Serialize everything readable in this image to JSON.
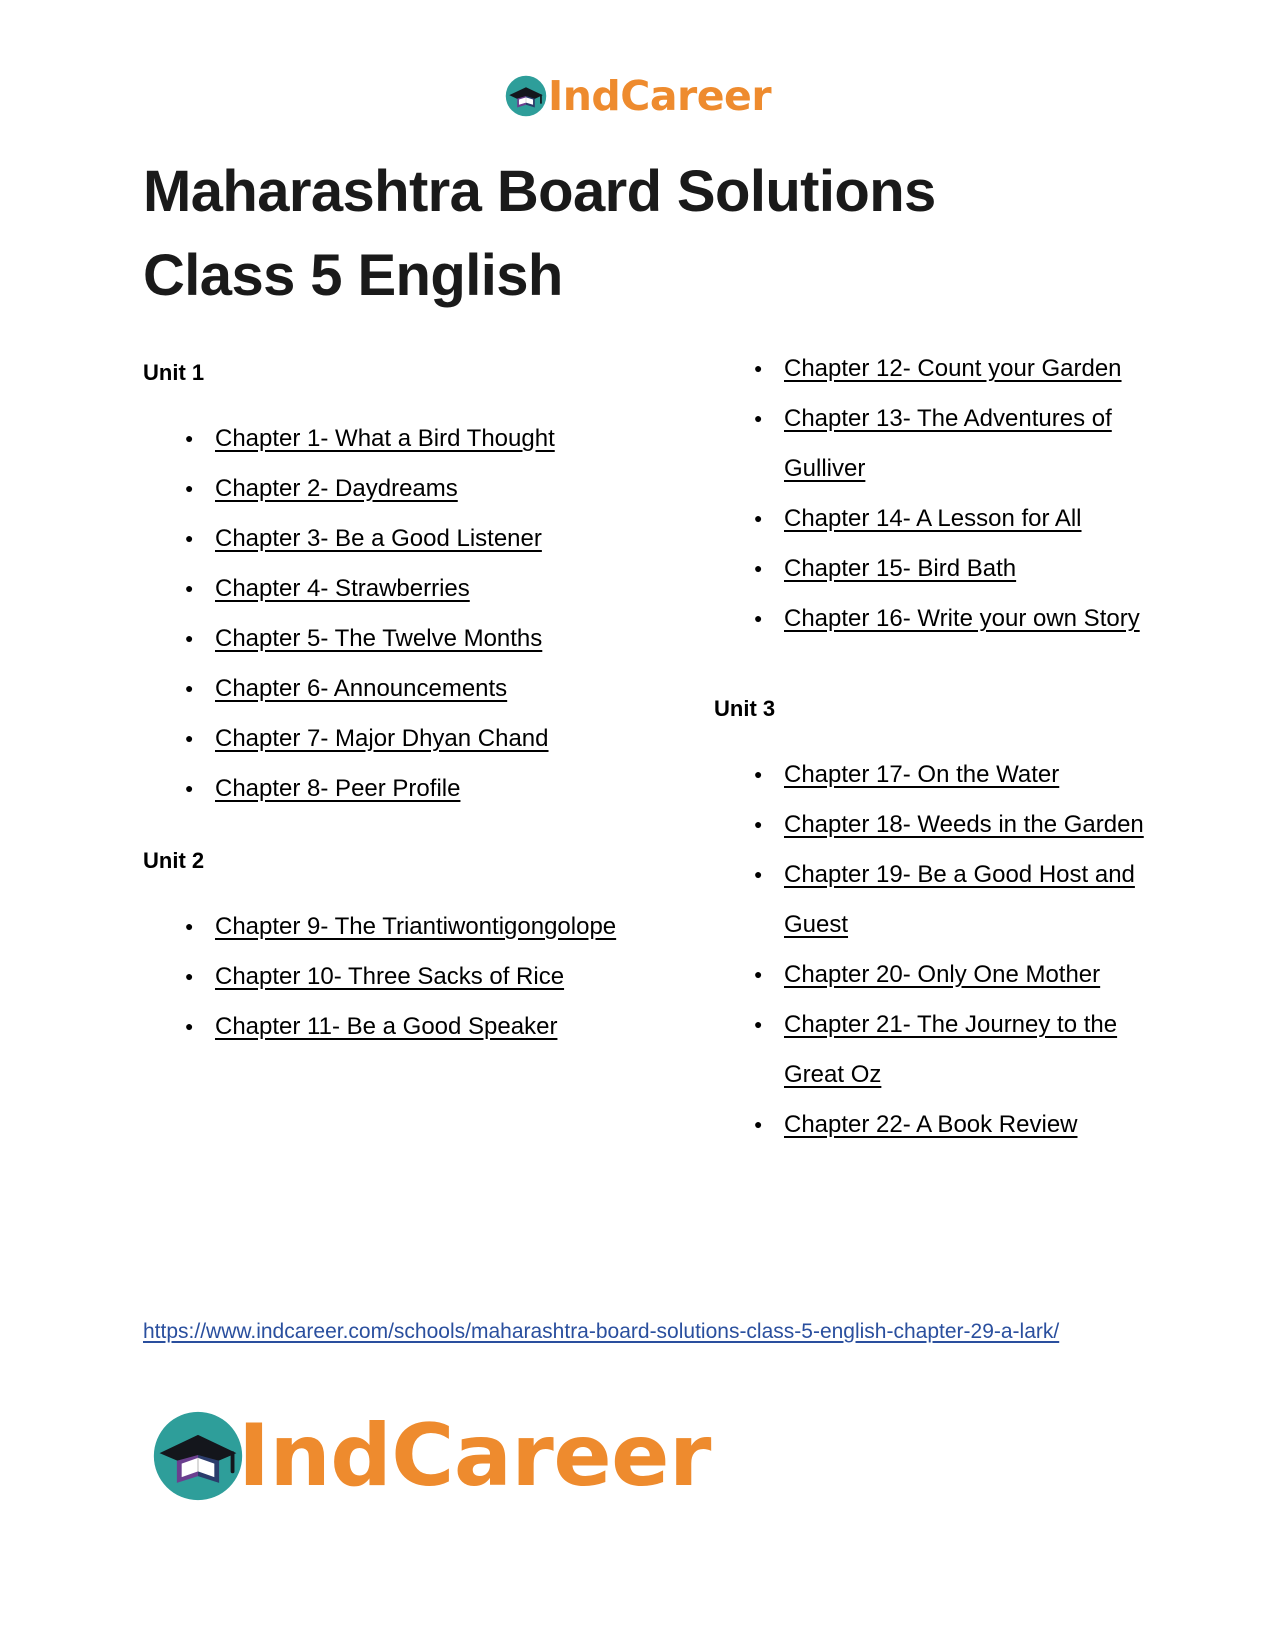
{
  "brand": {
    "name": "IndCareer",
    "logo_icon": "graduation-cap-book-icon",
    "orange": "#ee8b2e",
    "teal": "#2e9e9a"
  },
  "title": "Maharashtra Board Solutions Class 5 English",
  "columns": {
    "left": [
      {
        "heading": "Unit 1",
        "chapters": [
          "Chapter 1- What a Bird Thought",
          "Chapter 2- Daydreams",
          "Chapter 3- Be a Good Listener",
          "Chapter 4- Strawberries",
          "Chapter 5- The Twelve Months",
          "Chapter 6- Announcements",
          "Chapter 7- Major Dhyan Chand",
          "Chapter 8- Peer Profile"
        ]
      },
      {
        "heading": "Unit 2",
        "chapters": [
          "Chapter 9- The Triantiwontigongolope",
          "Chapter 10- Three Sacks of Rice",
          "Chapter 11- Be a Good Speaker"
        ]
      }
    ],
    "right": [
      {
        "heading": "",
        "chapters": [
          "Chapter 12- Count your Garden",
          "Chapter 13- The Adventures of Gulliver",
          "Chapter 14- A Lesson for All",
          "Chapter 15- Bird Bath",
          "Chapter 16- Write your own Story"
        ]
      },
      {
        "heading": "Unit 3",
        "chapters": [
          "Chapter 17- On the Water",
          "Chapter 18- Weeds in the Garden",
          "Chapter 19- Be a Good Host and Guest",
          "Chapter 20- Only One Mother",
          "Chapter 21- The Journey to the Great Oz",
          "Chapter 22- A Book Review"
        ]
      }
    ]
  },
  "footer": {
    "url": "https://www.indcareer.com/schools/maharashtra-board-solutions-class-5-english-chapter-29-a-lark/"
  }
}
